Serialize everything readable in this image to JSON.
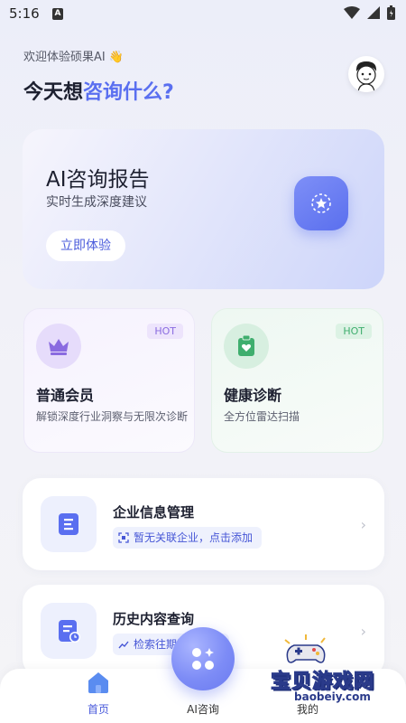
{
  "status_bar": {
    "time": "5:16",
    "notif_letter": "A"
  },
  "header": {
    "welcome": "欢迎体验硕果AI 👋",
    "headline_prefix": "今天想",
    "headline_highlight": "咨询什么",
    "headline_suffix": "?"
  },
  "hero": {
    "title": "AI咨询报告",
    "subtitle": "实时生成深度建议",
    "button": "立即体验"
  },
  "cards": [
    {
      "title": "普通会员",
      "badge": "HOT",
      "desc": "解锁深度行业洞察与无限次诊断"
    },
    {
      "title": "健康诊断",
      "badge": "HOT",
      "desc": "全方位雷达扫描"
    }
  ],
  "rows": [
    {
      "title": "企业信息管理",
      "tag": "暂无关联企业，点击添加"
    },
    {
      "title": "历史内容查询",
      "tag": "检索往期咨询记录"
    }
  ],
  "nav": {
    "home": "首页",
    "ai": "AI咨询",
    "mine": "我的"
  },
  "watermark": {
    "text": "宝贝游戏网",
    "url": "baobeiy.com"
  },
  "colors": {
    "accent": "#5a6ff0",
    "member": "#8a6be0",
    "health": "#3fae6e"
  }
}
